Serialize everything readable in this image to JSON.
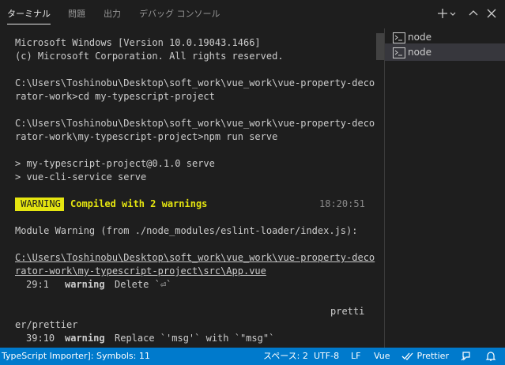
{
  "tabs": [
    {
      "label": "ターミナル",
      "active": true
    },
    {
      "label": "問題",
      "active": false
    },
    {
      "label": "出力",
      "active": false
    },
    {
      "label": "デバッグ コンソール",
      "active": false
    }
  ],
  "header_icons": [
    "plus-icon",
    "chevron-down-icon",
    "chevron-up-icon",
    "close-icon"
  ],
  "terminal": {
    "lines": [
      "Microsoft Windows [Version 10.0.19043.1466]",
      "(c) Microsoft Corporation. All rights reserved.",
      "",
      "C:\\Users\\Toshinobu\\Desktop\\soft_work\\vue_work\\vue-property-deco",
      "rator-work>cd my-typescript-project",
      "",
      "C:\\Users\\Toshinobu\\Desktop\\soft_work\\vue_work\\vue-property-deco",
      "rator-work\\my-typescript-project>npm run serve",
      "",
      "> my-typescript-project@0.1.0 serve",
      "> vue-cli-service serve"
    ],
    "warning_badge": " WARNING ",
    "compiled_text": "Compiled with 2 warnings",
    "time": "18:20:51",
    "module_warning": "Module Warning (from ./node_modules/eslint-loader/index.js):",
    "file_path_1": "C:\\Users\\Toshinobu\\Desktop\\soft_work\\vue_work\\vue-property-deco",
    "file_path_2": "rator-work\\my-typescript-project\\src\\App.vue",
    "warn1": {
      "pos": "29:1",
      "level": "warning",
      "msg": "Delete `⏎`"
    },
    "prettier_tail": "pretti",
    "prettier_rule": "er/prettier",
    "warn2": {
      "pos": "39:10",
      "level": "warning",
      "msg": "Replace `'msg'` with `\"msg\"`"
    }
  },
  "terminal_list": [
    {
      "label": "node",
      "selected": false
    },
    {
      "label": "node",
      "selected": true
    }
  ],
  "status_bar": {
    "left": "TypeScript Importer]: Symbols: 11",
    "spaces": "スペース: 2",
    "encoding": "UTF-8",
    "eol": "LF",
    "language": "Vue",
    "prettier": "Prettier"
  },
  "colors": {
    "background": "#1e1e1e",
    "statusbar": "#007acc",
    "warning_yellow": "#e5e510",
    "selection": "#37373d"
  }
}
